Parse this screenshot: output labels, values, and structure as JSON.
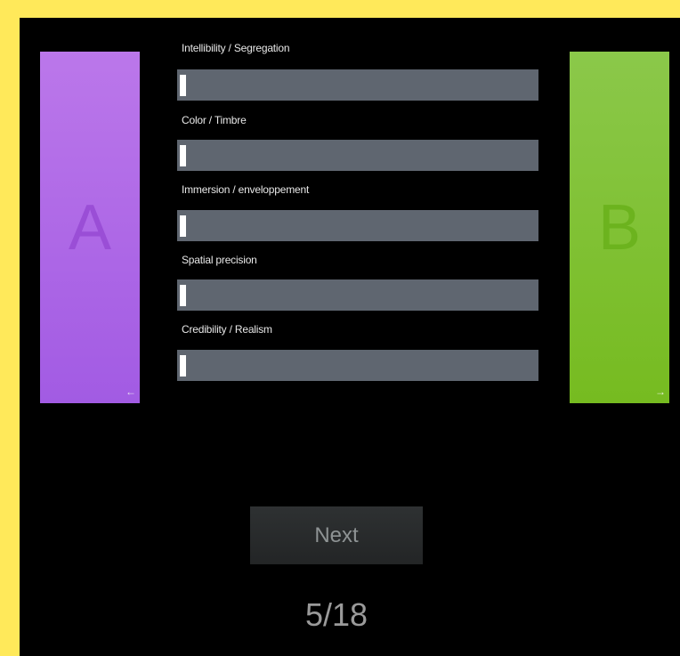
{
  "option_a": {
    "letter": "A",
    "arrow": "←"
  },
  "option_b": {
    "letter": "B",
    "arrow": "→"
  },
  "criteria": [
    {
      "label": "Intellibility / Segregation",
      "value": 0
    },
    {
      "label": "Color / Timbre",
      "value": 0
    },
    {
      "label": "Immersion / enveloppement",
      "value": 0
    },
    {
      "label": "Spatial precision",
      "value": 0
    },
    {
      "label": "Credibility / Realism",
      "value": 0
    }
  ],
  "next_label": "Next",
  "progress": "5/18",
  "colors": {
    "background": "#ffe95a",
    "stage": "#000000",
    "option_a": "#a96be6",
    "option_b": "#80c235",
    "slider_track": "#5f6670"
  }
}
